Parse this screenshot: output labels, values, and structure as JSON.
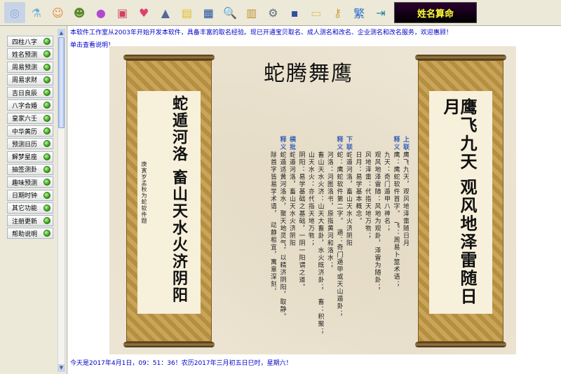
{
  "toolbar": {
    "icons": [
      {
        "name": "disc-icon",
        "glyph": "◎"
      },
      {
        "name": "test-tube-icon",
        "glyph": "⚗"
      },
      {
        "name": "cartoon-face-icon",
        "glyph": "☺"
      },
      {
        "name": "cartoon-character-icon",
        "glyph": "☻"
      },
      {
        "name": "purple-ball-icon",
        "glyph": "●"
      },
      {
        "name": "cards-icon",
        "glyph": "▣"
      },
      {
        "name": "hearts-icon",
        "glyph": "♥"
      },
      {
        "name": "landscape-icon",
        "glyph": "▲"
      },
      {
        "name": "yellow-book-icon",
        "glyph": "▤"
      },
      {
        "name": "calendar-icon",
        "glyph": "▦"
      },
      {
        "name": "magnifier-icon",
        "glyph": "🔍"
      },
      {
        "name": "book-icon",
        "glyph": "▥"
      },
      {
        "name": "toolbox-icon",
        "glyph": "⚙"
      },
      {
        "name": "save-icon",
        "glyph": "▪"
      },
      {
        "name": "folder-icon",
        "glyph": "▭"
      },
      {
        "name": "key-icon",
        "glyph": "⚷"
      },
      {
        "name": "traditional-char-icon",
        "glyph": "繁"
      },
      {
        "name": "exit-icon",
        "glyph": "⇥"
      }
    ],
    "brand_text": "姓名算命"
  },
  "sidebar": {
    "items": [
      {
        "label": "四柱八字"
      },
      {
        "label": "姓名预测"
      },
      {
        "label": "周易预测"
      },
      {
        "label": "周易求财"
      },
      {
        "label": "吉日良辰"
      },
      {
        "label": "八字合婚"
      },
      {
        "label": "皇家六壬"
      },
      {
        "label": "中华黄历"
      },
      {
        "label": "预测日历"
      },
      {
        "label": "解梦星座"
      },
      {
        "label": "抽签测卦"
      },
      {
        "label": "趣味预测"
      },
      {
        "label": "日期时钟"
      },
      {
        "label": "其它功能"
      },
      {
        "label": "注册更新"
      },
      {
        "label": "帮助说明"
      }
    ]
  },
  "main": {
    "notice": "本软件工作室从2003年开始开发本软件，具备丰富的取名经验。现已开通宝贝取名、成人测名和改名、企业测名和改名服务，欢迎惠顾！",
    "help_link": "单击查看说明！",
    "status": "今天是2017年4月1日，09：51：36！农历2017年三月初五日巳时，星期六！"
  },
  "artwork": {
    "title": "蛇腾舞鹰",
    "left_scroll_text": "蛇遁河洛 畜山天水火济阴阳",
    "left_scroll_signature": "庚寅岁孟秋为蛇软件题",
    "right_scroll_text": "鹰飞九天 观风地泽雷随日月",
    "headers": [
      "上联",
      "释义",
      "下联",
      "释义",
      "横批",
      "释义"
    ],
    "columns": [
      "鹰飞九天，观风地泽雷随日月",
      "鹰：鹰蛇软件首字。　飞：周易卜筮术语；",
      "九天：奇门遁甲八神名；",
      "观风地泽雷随：风地为观卦，泽雷为随卦；",
      "风地泽雷：代指天地万物；",
      "日月：易学基本概念。",
      "蛇遁河洛，畜山天水火济阴阳",
      "蛇：鹰蛇软件第二字。　遁：奇门遁甲或天山遁卦；",
      "河洛：河图洛书，原指黄河和洛水；",
      "畜山天水火济：山天大畜卦，水火既济卦；　畜：积聚；",
      "山天水火：亦代指天地万物；",
      "阴阳：易学基础之基础，一阴一阳谓之道。",
      "蛇遁河洛，畜山天水火济阴阳",
      "蛇遁适黄河洛水，聚天地灵气，以精济阴阳，取静。",
      "除首字皆易学术语，　动静相宜，寓意深刻。"
    ]
  }
}
